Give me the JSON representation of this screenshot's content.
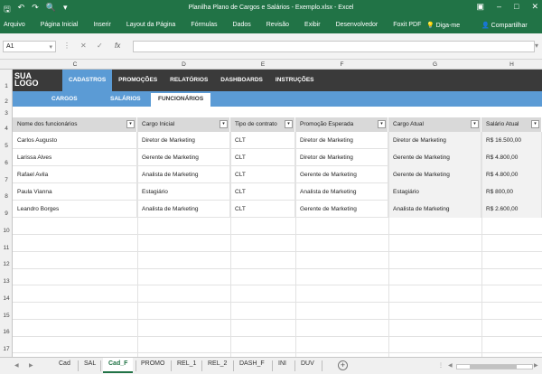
{
  "window": {
    "title": "Planilha Plano de Cargos e Salários - Exemplo.xlsx - Excel",
    "qa_icons": [
      "save-icon",
      "undo-icon",
      "redo-icon",
      "print-preview-icon",
      "customize-icon"
    ],
    "controls": [
      "ribbon-display-icon",
      "minimize-icon",
      "maximize-icon",
      "close-icon"
    ]
  },
  "ribbon": {
    "tabs": [
      "Arquivo",
      "Página Inicial",
      "Inserir",
      "Layout da Página",
      "Fórmulas",
      "Dados",
      "Revisão",
      "Exibir",
      "Desenvolvedor",
      "Foxit PDF"
    ],
    "tell_me": "Diga-me",
    "share": "Compartilhar"
  },
  "formula_bar": {
    "name_box": "A1",
    "fx": "fx",
    "formula": ""
  },
  "columns": [
    "C",
    "D",
    "E",
    "F",
    "G",
    "H"
  ],
  "rows": [
    "1",
    "2",
    "3",
    "4",
    "5",
    "6",
    "7",
    "8",
    "9",
    "10",
    "11",
    "12",
    "13",
    "14",
    "15",
    "16",
    "17"
  ],
  "brand": {
    "logo": "SUA LOGO"
  },
  "nav": [
    "CADASTROS",
    "PROMOÇÕES",
    "RELATÓRIOS",
    "DASHBOARDS",
    "INSTRUÇÕES"
  ],
  "subnav": [
    "CARGOS",
    "SALÁRIOS",
    "FUNCIONÁRIOS"
  ],
  "table": {
    "headers": [
      "Nome dos funcionários",
      "Cargo Inicial",
      "Tipo de contrato",
      "Promoção Esperada",
      "Cargo Atual",
      "Salário Atual"
    ],
    "rows": [
      [
        "Carlos Augusto",
        "Diretor de Marketing",
        "CLT",
        "Diretor de Marketing",
        "Diretor de Marketing",
        "R$ 16.500,00"
      ],
      [
        "Larissa Alves",
        "Gerente de Marketing",
        "CLT",
        "Diretor de Marketing",
        "Gerente de Marketing",
        "R$ 4.800,00"
      ],
      [
        "Rafael Avila",
        "Analista de Marketing",
        "CLT",
        "Gerente de Marketing",
        "Gerente de Marketing",
        "R$ 4.800,00"
      ],
      [
        "Paula Vianna",
        "Estagiário",
        "CLT",
        "Analista de Marketing",
        "Estagiário",
        "R$ 800,00"
      ],
      [
        "Leandro Borges",
        "Analista de Marketing",
        "CLT",
        "Gerente de Marketing",
        "Analista de Marketing",
        "R$ 2.600,00"
      ]
    ]
  },
  "sheets": [
    "Cad",
    "SAL",
    "Cad_F",
    "PROMO",
    "REL_1",
    "REL_2",
    "DASH_F",
    "INI",
    "DUV"
  ],
  "active_sheet": "Cad_F",
  "colors": {
    "excel_green": "#217346",
    "nav_blue": "#5b9bd5",
    "brand_dark": "#3a3a3a"
  }
}
